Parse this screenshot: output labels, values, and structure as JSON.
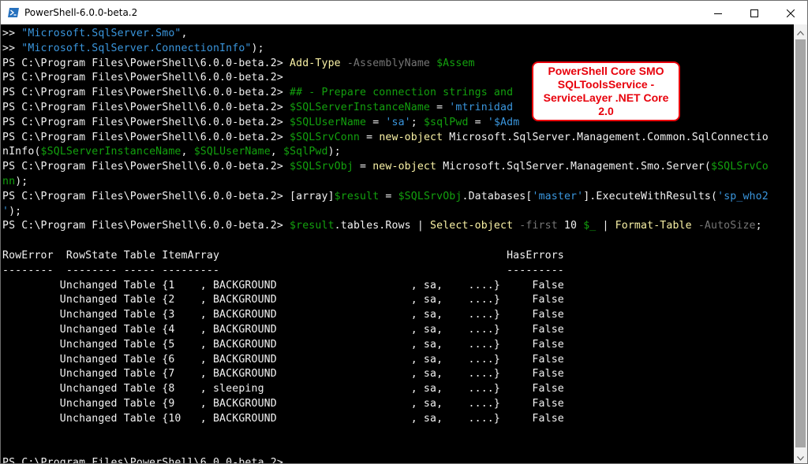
{
  "window": {
    "title": "PowerShell-6.0.0-beta.2",
    "controls": [
      "minimize",
      "maximize",
      "close"
    ]
  },
  "colors": {
    "background": "#000000",
    "text": "#f2f2f2",
    "command": "#f9f1a5",
    "parameter": "#767676",
    "variable": "#13a10e",
    "string": "#3a96dd",
    "callout_border": "#e8000b"
  },
  "callout": {
    "text": "PowerShell Core SMO SQLToolsService - ServiceLayer .NET Core 2.0"
  },
  "console_lines": [
    [
      {
        "t": ">> ",
        "c": "w"
      },
      {
        "t": "\"Microsoft.SqlServer.Smo\"",
        "c": "s"
      },
      {
        "t": ",",
        "c": "w"
      }
    ],
    [
      {
        "t": ">> ",
        "c": "w"
      },
      {
        "t": "\"Microsoft.SqlServer.ConnectionInfo\"",
        "c": "s"
      },
      {
        "t": ");",
        "c": "w"
      }
    ],
    [
      {
        "t": "PS C:\\Program Files\\PowerShell\\6.0.0-beta.2> ",
        "c": "w"
      },
      {
        "t": "Add-Type",
        "c": "y"
      },
      {
        "t": " -AssemblyName ",
        "c": "g"
      },
      {
        "t": "$Assem",
        "c": "v"
      }
    ],
    [
      {
        "t": "PS C:\\Program Files\\PowerShell\\6.0.0-beta.2>",
        "c": "w"
      }
    ],
    [
      {
        "t": "PS C:\\Program Files\\PowerShell\\6.0.0-beta.2> ",
        "c": "w"
      },
      {
        "t": "## - Prepare connection strings and",
        "c": "k"
      }
    ],
    [
      {
        "t": "PS C:\\Program Files\\PowerShell\\6.0.0-beta.2> ",
        "c": "w"
      },
      {
        "t": "$SQLServerInstanceName",
        "c": "v"
      },
      {
        "t": " = ",
        "c": "w"
      },
      {
        "t": "'mtrinidad",
        "c": "s"
      }
    ],
    [
      {
        "t": "PS C:\\Program Files\\PowerShell\\6.0.0-beta.2> ",
        "c": "w"
      },
      {
        "t": "$SQLUserName",
        "c": "v"
      },
      {
        "t": " = ",
        "c": "w"
      },
      {
        "t": "'sa'",
        "c": "s"
      },
      {
        "t": "; ",
        "c": "w"
      },
      {
        "t": "$sqlPwd",
        "c": "v"
      },
      {
        "t": " = ",
        "c": "w"
      },
      {
        "t": "'$Adm",
        "c": "s"
      }
    ],
    [
      {
        "t": "PS C:\\Program Files\\PowerShell\\6.0.0-beta.2> ",
        "c": "w"
      },
      {
        "t": "$SQLSrvConn",
        "c": "v"
      },
      {
        "t": " = ",
        "c": "w"
      },
      {
        "t": "new-object",
        "c": "y"
      },
      {
        "t": " Microsoft.SqlServer.Management.Common.SqlConnectio",
        "c": "w"
      }
    ],
    [
      {
        "t": "nInfo(",
        "c": "w"
      },
      {
        "t": "$SQLServerInstanceName",
        "c": "v"
      },
      {
        "t": ", ",
        "c": "w"
      },
      {
        "t": "$SQLUserName",
        "c": "v"
      },
      {
        "t": ", ",
        "c": "w"
      },
      {
        "t": "$SqlPwd",
        "c": "v"
      },
      {
        "t": ");",
        "c": "w"
      }
    ],
    [
      {
        "t": "PS C:\\Program Files\\PowerShell\\6.0.0-beta.2> ",
        "c": "w"
      },
      {
        "t": "$SQLSrvObj",
        "c": "v"
      },
      {
        "t": " = ",
        "c": "w"
      },
      {
        "t": "new-object",
        "c": "y"
      },
      {
        "t": " Microsoft.SqlServer.Management.Smo.Server(",
        "c": "w"
      },
      {
        "t": "$SQLSrvCo",
        "c": "v"
      }
    ],
    [
      {
        "t": "nn",
        "c": "v"
      },
      {
        "t": ");",
        "c": "w"
      }
    ],
    [
      {
        "t": "PS C:\\Program Files\\PowerShell\\6.0.0-beta.2> ",
        "c": "w"
      },
      {
        "t": "[array]",
        "c": "w"
      },
      {
        "t": "$result",
        "c": "v"
      },
      {
        "t": " = ",
        "c": "w"
      },
      {
        "t": "$SQLSrvObj",
        "c": "v"
      },
      {
        "t": ".Databases[",
        "c": "w"
      },
      {
        "t": "'master'",
        "c": "s"
      },
      {
        "t": "].ExecuteWithResults(",
        "c": "w"
      },
      {
        "t": "'sp_who2",
        "c": "s"
      }
    ],
    [
      {
        "t": "'",
        "c": "s"
      },
      {
        "t": ");",
        "c": "w"
      }
    ],
    [
      {
        "t": "PS C:\\Program Files\\PowerShell\\6.0.0-beta.2> ",
        "c": "w"
      },
      {
        "t": "$result",
        "c": "v"
      },
      {
        "t": ".tables.Rows | ",
        "c": "w"
      },
      {
        "t": "Select-object",
        "c": "y"
      },
      {
        "t": " -first ",
        "c": "g"
      },
      {
        "t": "10 ",
        "c": "w"
      },
      {
        "t": "$_",
        "c": "v"
      },
      {
        "t": " | ",
        "c": "w"
      },
      {
        "t": "Format-Table",
        "c": "y"
      },
      {
        "t": " -AutoSize",
        "c": "g"
      },
      {
        "t": ";",
        "c": "w"
      }
    ],
    [],
    [
      {
        "t": "RowError  RowState Table ItemArray                                             HasErrors",
        "c": "w"
      }
    ],
    [
      {
        "t": "--------  -------- ----- ---------                                             ---------",
        "c": "w"
      }
    ],
    [
      {
        "t": "         Unchanged Table {1    , BACKGROUND                     , sa,    ....}     False",
        "c": "w"
      }
    ],
    [
      {
        "t": "         Unchanged Table {2    , BACKGROUND                     , sa,    ....}     False",
        "c": "w"
      }
    ],
    [
      {
        "t": "         Unchanged Table {3    , BACKGROUND                     , sa,    ....}     False",
        "c": "w"
      }
    ],
    [
      {
        "t": "         Unchanged Table {4    , BACKGROUND                     , sa,    ....}     False",
        "c": "w"
      }
    ],
    [
      {
        "t": "         Unchanged Table {5    , BACKGROUND                     , sa,    ....}     False",
        "c": "w"
      }
    ],
    [
      {
        "t": "         Unchanged Table {6    , BACKGROUND                     , sa,    ....}     False",
        "c": "w"
      }
    ],
    [
      {
        "t": "         Unchanged Table {7    , BACKGROUND                     , sa,    ....}     False",
        "c": "w"
      }
    ],
    [
      {
        "t": "         Unchanged Table {8    , sleeping                       , sa,    ....}     False",
        "c": "w"
      }
    ],
    [
      {
        "t": "         Unchanged Table {9    , BACKGROUND                     , sa,    ....}     False",
        "c": "w"
      }
    ],
    [
      {
        "t": "         Unchanged Table {10   , BACKGROUND                     , sa,    ....}     False",
        "c": "w"
      }
    ],
    [],
    [],
    [
      {
        "t": "PS C:\\Program Files\\PowerShell\\6.0.0-beta.2> ",
        "c": "w"
      }
    ]
  ]
}
